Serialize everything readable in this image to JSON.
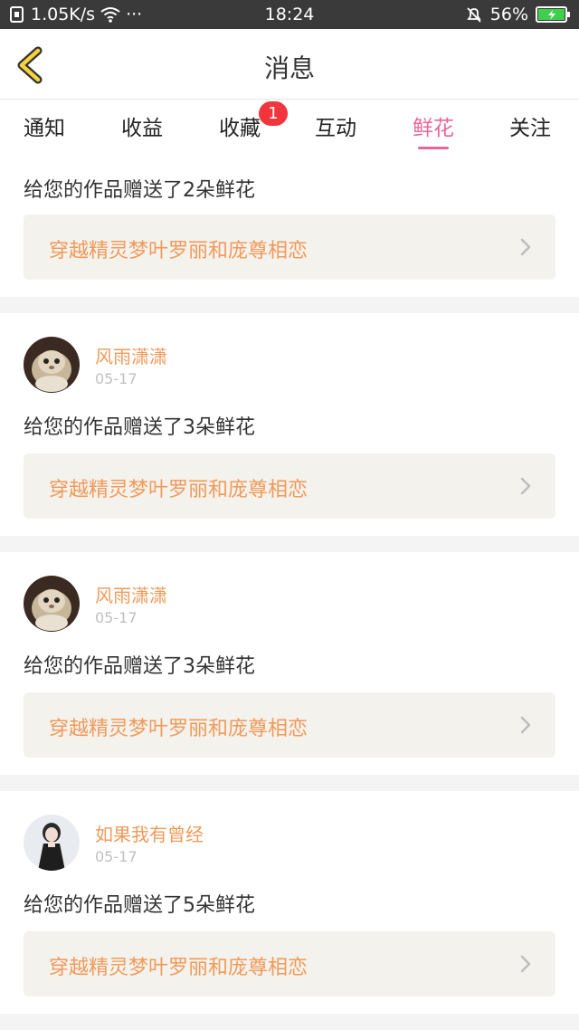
{
  "status_bar": {
    "network_speed": "1.05K/s",
    "more": "···",
    "time": "18:24",
    "battery": "56%"
  },
  "header": {
    "title": "消息",
    "accent_color": "#e8669a"
  },
  "tabs": [
    {
      "label": "通知",
      "active": false
    },
    {
      "label": "收益",
      "active": false
    },
    {
      "label": "收藏",
      "active": false,
      "badge": "1"
    },
    {
      "label": "互动",
      "active": false
    },
    {
      "label": "鲜花",
      "active": true
    },
    {
      "label": "关注",
      "active": false
    }
  ],
  "items": [
    {
      "message": "给您的作品赠送了2朵鲜花",
      "work_title": "穿越精灵梦叶罗丽和庞尊相恋"
    },
    {
      "user": "风雨潇潇",
      "date": "05-17",
      "avatar": "cat-avatar",
      "message": "给您的作品赠送了3朵鲜花",
      "work_title": "穿越精灵梦叶罗丽和庞尊相恋"
    },
    {
      "user": "风雨潇潇",
      "date": "05-17",
      "avatar": "cat-avatar",
      "message": "给您的作品赠送了3朵鲜花",
      "work_title": "穿越精灵梦叶罗丽和庞尊相恋"
    },
    {
      "user": "如果我有曾经",
      "date": "05-17",
      "avatar": "girl-avatar",
      "message": "给您的作品赠送了5朵鲜花",
      "work_title": "穿越精灵梦叶罗丽和庞尊相恋"
    }
  ]
}
